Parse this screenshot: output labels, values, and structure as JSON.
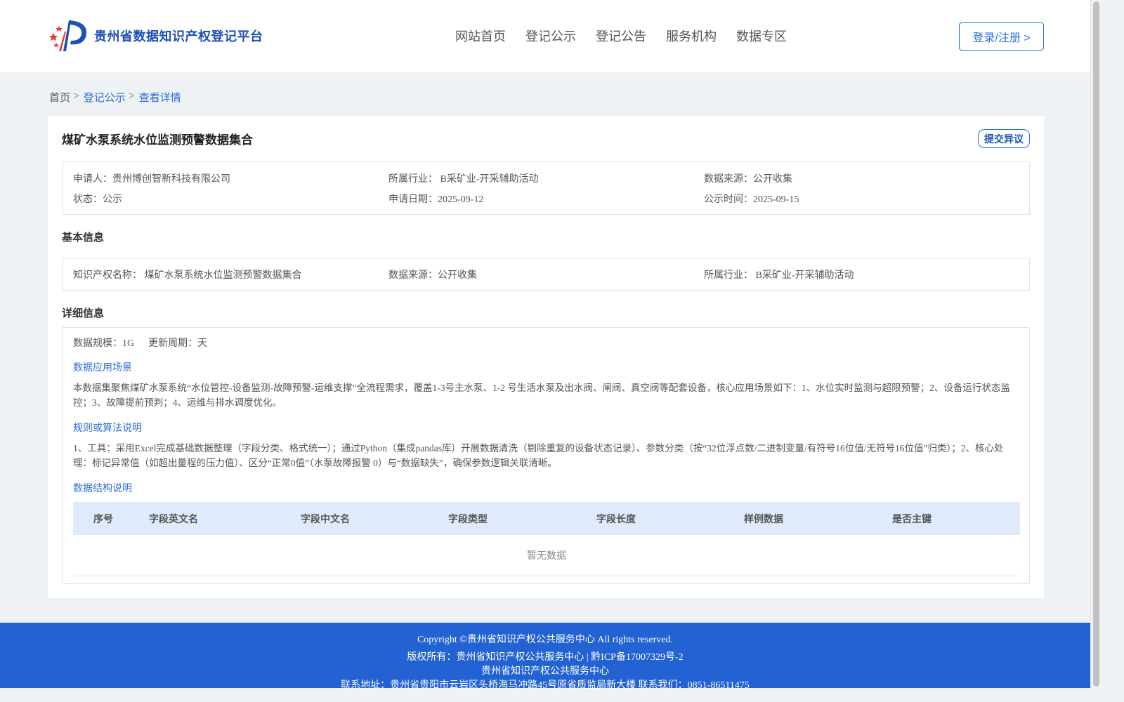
{
  "header": {
    "logo_text": "贵州省数据知识产权登记平台",
    "nav": [
      "网站首页",
      "登记公示",
      "登记公告",
      "服务机构",
      "数据专区"
    ],
    "login_label": "登录/注册 >"
  },
  "breadcrumb": {
    "home": "首页",
    "sep": ">",
    "level1": "登记公示",
    "current": "查看详情"
  },
  "detail": {
    "title": "煤矿水泵系统水位监测预警数据集合",
    "objection_label": "提交异议",
    "summary": {
      "applicant": "申请人：贵州博创智新科技有限公司",
      "industry": "所属行业： B采矿业-开采辅助活动",
      "source": "数据来源：公开收集",
      "status": "状态：公示",
      "apply_date": "申请日期：2025-09-12",
      "publish_date": "公示时间：2025-09-15"
    },
    "basic_title": "基本信息",
    "basic": {
      "ip_name": "知识产权名称： 煤矿水泵系统水位监测预警数据集合",
      "source": "数据来源：公开收集",
      "industry": "所属行业： B采矿业-开采辅助活动"
    },
    "detail_title": "详细信息",
    "scale": "数据规模：1G",
    "cycle": "更新周期：天",
    "scenario_title": "数据应用场景",
    "scenario_text": "本数据集聚焦煤矿水泵系统“水位管控-设备监测-故障预警-运维支撑”全流程需求，覆盖1-3号主水泵、1-2 号生活水泵及出水阀、闸阀、真空阀等配套设备，核心应用场景如下：1、水位实时监测与超限预警；2、设备运行状态监控；3、故障提前预判；4、运维与排水调度优化。",
    "rules_title": "规则或算法说明",
    "rules_text": "1、工具：采用Excel完成基础数据整理（字段分类、格式统一）；通过Python（集成pandas库）开展数据清洗（剔除重复的设备状态记录）、参数分类（按“32位浮点数/二进制变量/有符号16位值/无符号16位值”归类）；2、核心处理：标记异常值（如超出量程的压力值）、区分“正常0值”（水泵故障报警 0）与“数据缺失”，确保参数逻辑关联清晰。",
    "structure_title": "数据结构说明",
    "table_headers": [
      "序号",
      "字段英文名",
      "字段中文名",
      "字段类型",
      "字段长度",
      "样例数据",
      "是否主键"
    ],
    "empty_text": "暂无数据"
  },
  "footer": {
    "copyright": "Copyright ©贵州省知识产权公共服务中心 All rights reserved.",
    "owner": "版权所有：贵州省知识产权公共服务中心 | 黔ICP备17007329号-2",
    "org": "贵州省知识产权公共服务中心",
    "contact": "联系地址：贵州省贵阳市云岩区头桥海马冲路45号原省质监局新大楼 联系我们：0851-86511475"
  },
  "colors": {
    "accent": "#2b6fd9",
    "footer_bg": "#2262d2",
    "table_head_bg": "#dfeafb"
  }
}
